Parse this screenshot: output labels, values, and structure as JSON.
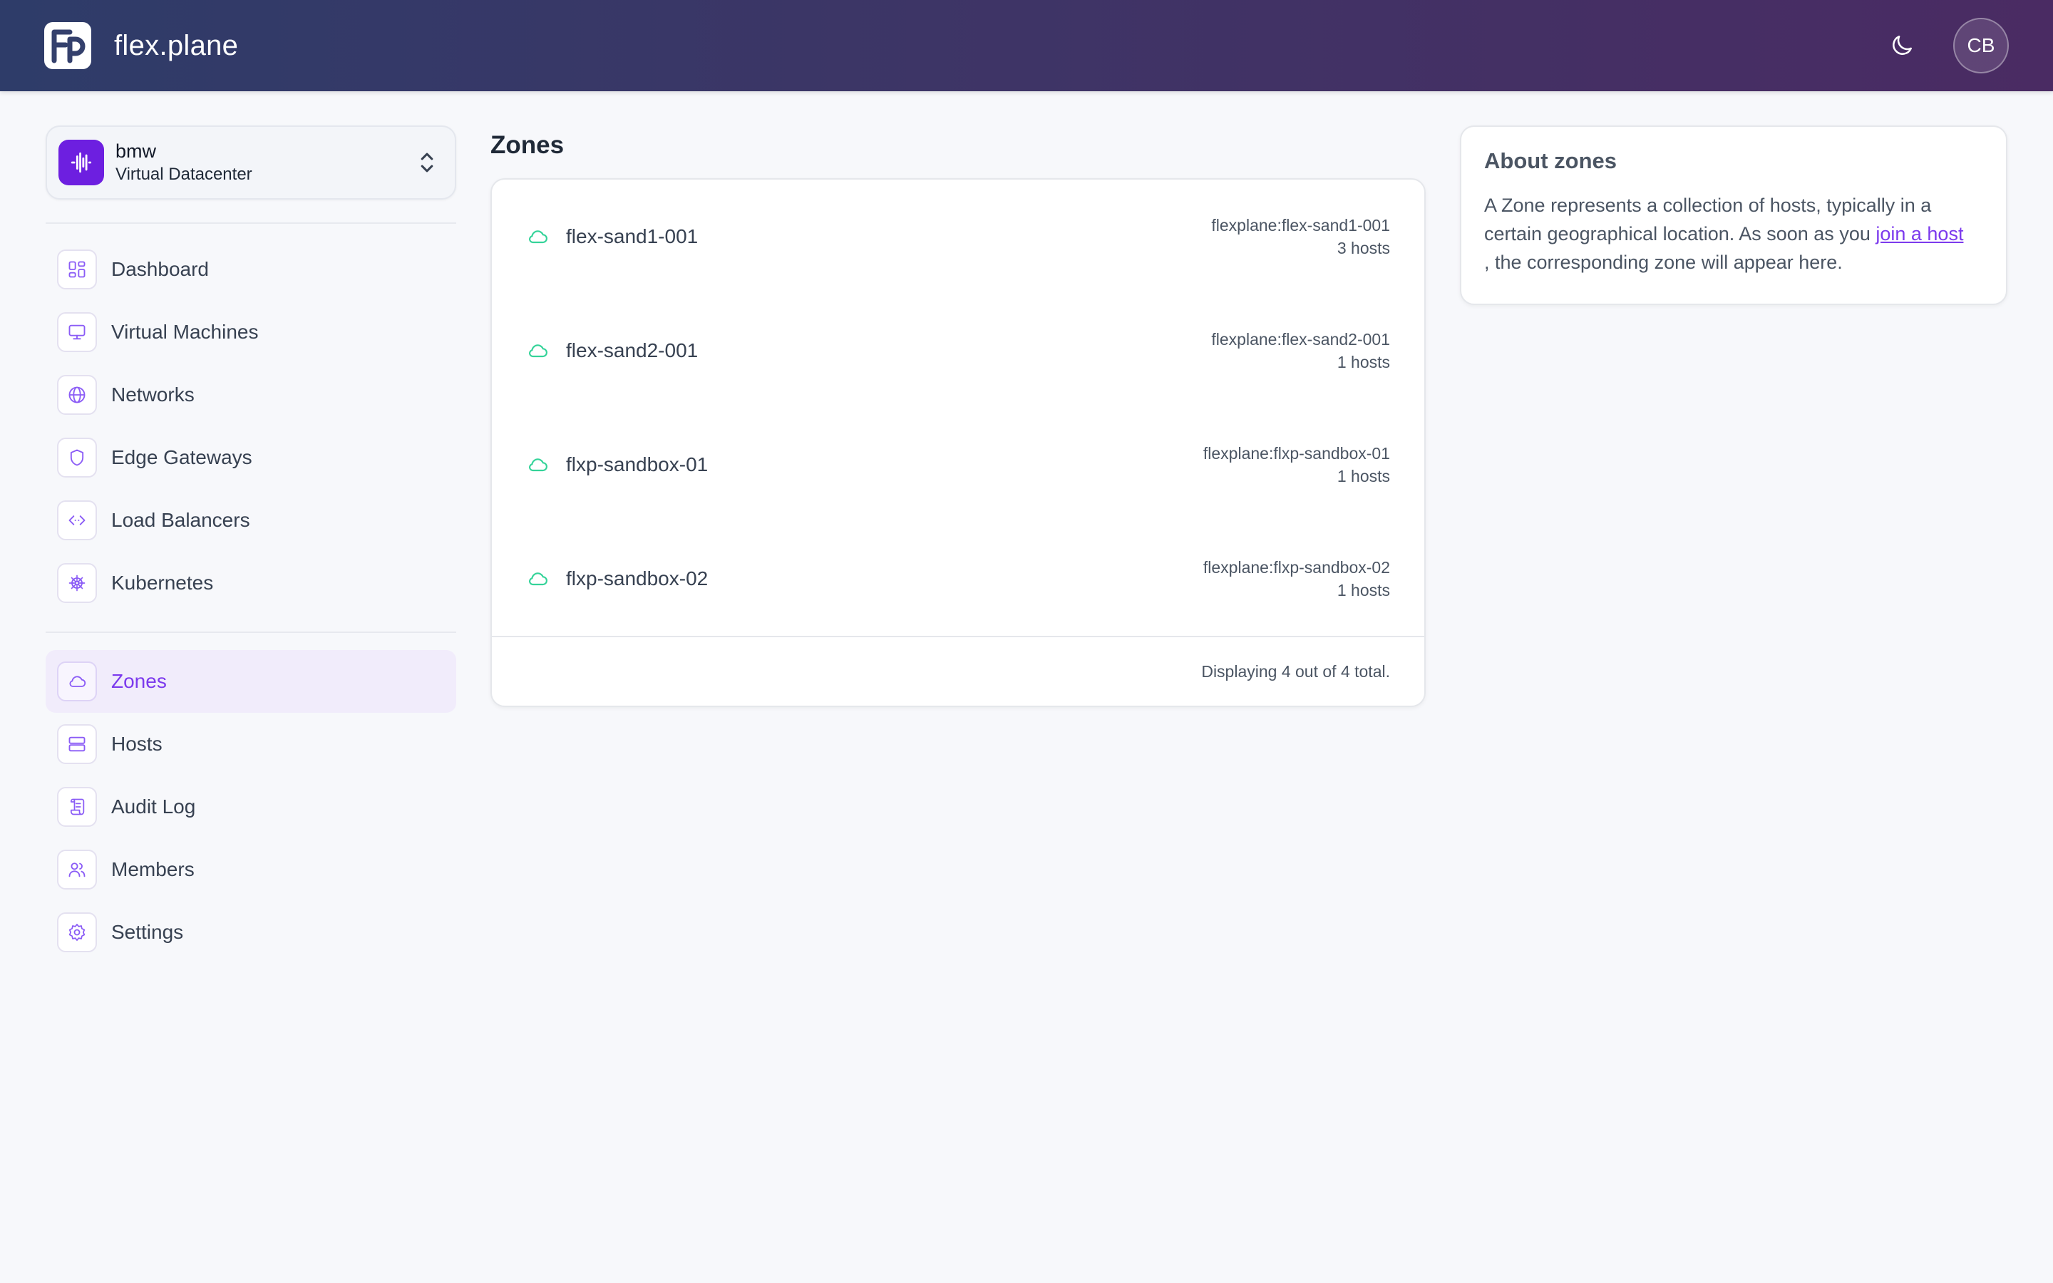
{
  "app": {
    "name": "flex.plane",
    "user_initials": "CB"
  },
  "icons": {
    "logo": "flexplane-logo-icon",
    "theme_toggle": "moon-icon",
    "org": "waveform-icon",
    "org_switch": "chevron-up-down-icon",
    "zone": "cloud-icon"
  },
  "colors": {
    "accent": "#7c3aed",
    "org_icon_bg": "#6d1fe0",
    "zone_icon": "#34d399",
    "header_start": "#2e3c69",
    "header_end": "#4a2b63"
  },
  "org": {
    "name": "bmw",
    "type": "Virtual Datacenter"
  },
  "nav": {
    "primary": [
      {
        "label": "Dashboard",
        "icon": "dashboard-icon"
      },
      {
        "label": "Virtual Machines",
        "icon": "monitor-icon"
      },
      {
        "label": "Networks",
        "icon": "globe-icon"
      },
      {
        "label": "Edge Gateways",
        "icon": "shield-icon"
      },
      {
        "label": "Load Balancers",
        "icon": "code-arrows-icon"
      },
      {
        "label": "Kubernetes",
        "icon": "helm-wheel-icon"
      }
    ],
    "secondary": [
      {
        "label": "Zones",
        "icon": "cloud-icon",
        "active": true
      },
      {
        "label": "Hosts",
        "icon": "server-icon"
      },
      {
        "label": "Audit Log",
        "icon": "scroll-icon"
      },
      {
        "label": "Members",
        "icon": "users-icon"
      },
      {
        "label": "Settings",
        "icon": "gear-icon"
      }
    ]
  },
  "page": {
    "title": "Zones"
  },
  "zones": [
    {
      "name": "flex-sand1-001",
      "id": "flexplane:flex-sand1-001",
      "hosts": "3 hosts"
    },
    {
      "name": "flex-sand2-001",
      "id": "flexplane:flex-sand2-001",
      "hosts": "1 hosts"
    },
    {
      "name": "flxp-sandbox-01",
      "id": "flexplane:flxp-sandbox-01",
      "hosts": "1 hosts"
    },
    {
      "name": "flxp-sandbox-02",
      "id": "flexplane:flxp-sandbox-02",
      "hosts": "1 hosts"
    }
  ],
  "list_footer": "Displaying 4 out of 4 total.",
  "about": {
    "title": "About zones",
    "text_before": "A Zone represents a collection of hosts, typically in a certain geographical location. As soon as you ",
    "link": "join a host",
    "text_after": ", the corresponding zone will appear here."
  }
}
